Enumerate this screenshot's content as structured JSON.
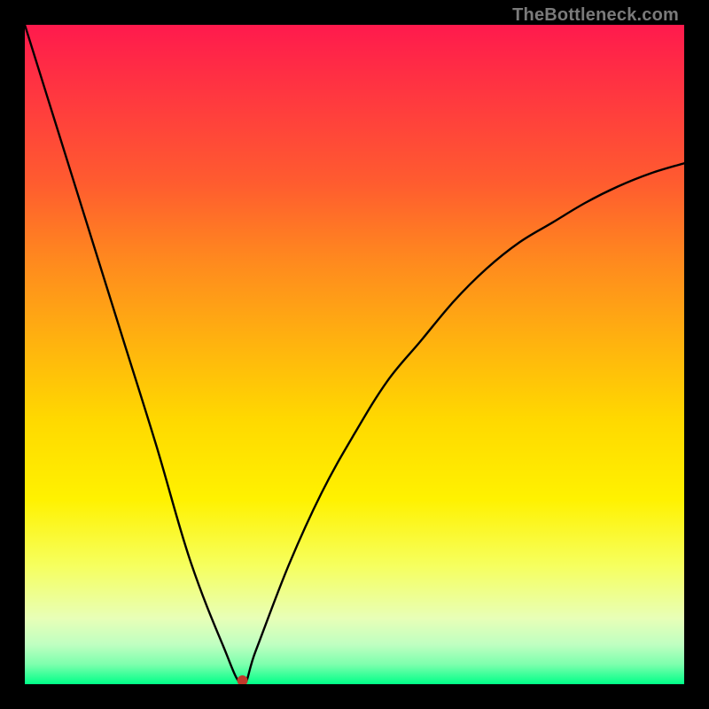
{
  "watermark_text": "TheBottleneck.com",
  "chart_data": {
    "type": "line",
    "title": "",
    "xlabel": "",
    "ylabel": "",
    "xlim": [
      0,
      100
    ],
    "ylim": [
      0,
      100
    ],
    "annotations": [
      {
        "text": "TheBottleneck.com",
        "position": "top-right"
      }
    ],
    "series": [
      {
        "name": "bottleneck-curve",
        "x": [
          0,
          5,
          10,
          15,
          20,
          25,
          30,
          33,
          35,
          40,
          45,
          50,
          55,
          60,
          65,
          70,
          75,
          80,
          85,
          90,
          95,
          100
        ],
        "y": [
          100,
          84,
          68,
          52,
          36,
          19,
          6,
          0,
          5,
          18,
          29,
          38,
          46,
          52,
          58,
          63,
          67,
          70,
          73,
          75.5,
          77.5,
          79
        ]
      }
    ],
    "marker": {
      "x": 33,
      "y": 0,
      "color": "#c0392b"
    },
    "background_gradient": {
      "direction": "vertical",
      "stops": [
        {
          "pos": 0.0,
          "color": "#ff1a4d"
        },
        {
          "pos": 0.12,
          "color": "#ff3b3e"
        },
        {
          "pos": 0.24,
          "color": "#ff5c2f"
        },
        {
          "pos": 0.36,
          "color": "#ff8a1e"
        },
        {
          "pos": 0.48,
          "color": "#ffb20f"
        },
        {
          "pos": 0.6,
          "color": "#ffd900"
        },
        {
          "pos": 0.72,
          "color": "#fff200"
        },
        {
          "pos": 0.82,
          "color": "#f6ff5e"
        },
        {
          "pos": 0.9,
          "color": "#e8ffb7"
        },
        {
          "pos": 0.94,
          "color": "#bfffc1"
        },
        {
          "pos": 0.97,
          "color": "#7dffad"
        },
        {
          "pos": 1.0,
          "color": "#00ff88"
        }
      ]
    }
  }
}
